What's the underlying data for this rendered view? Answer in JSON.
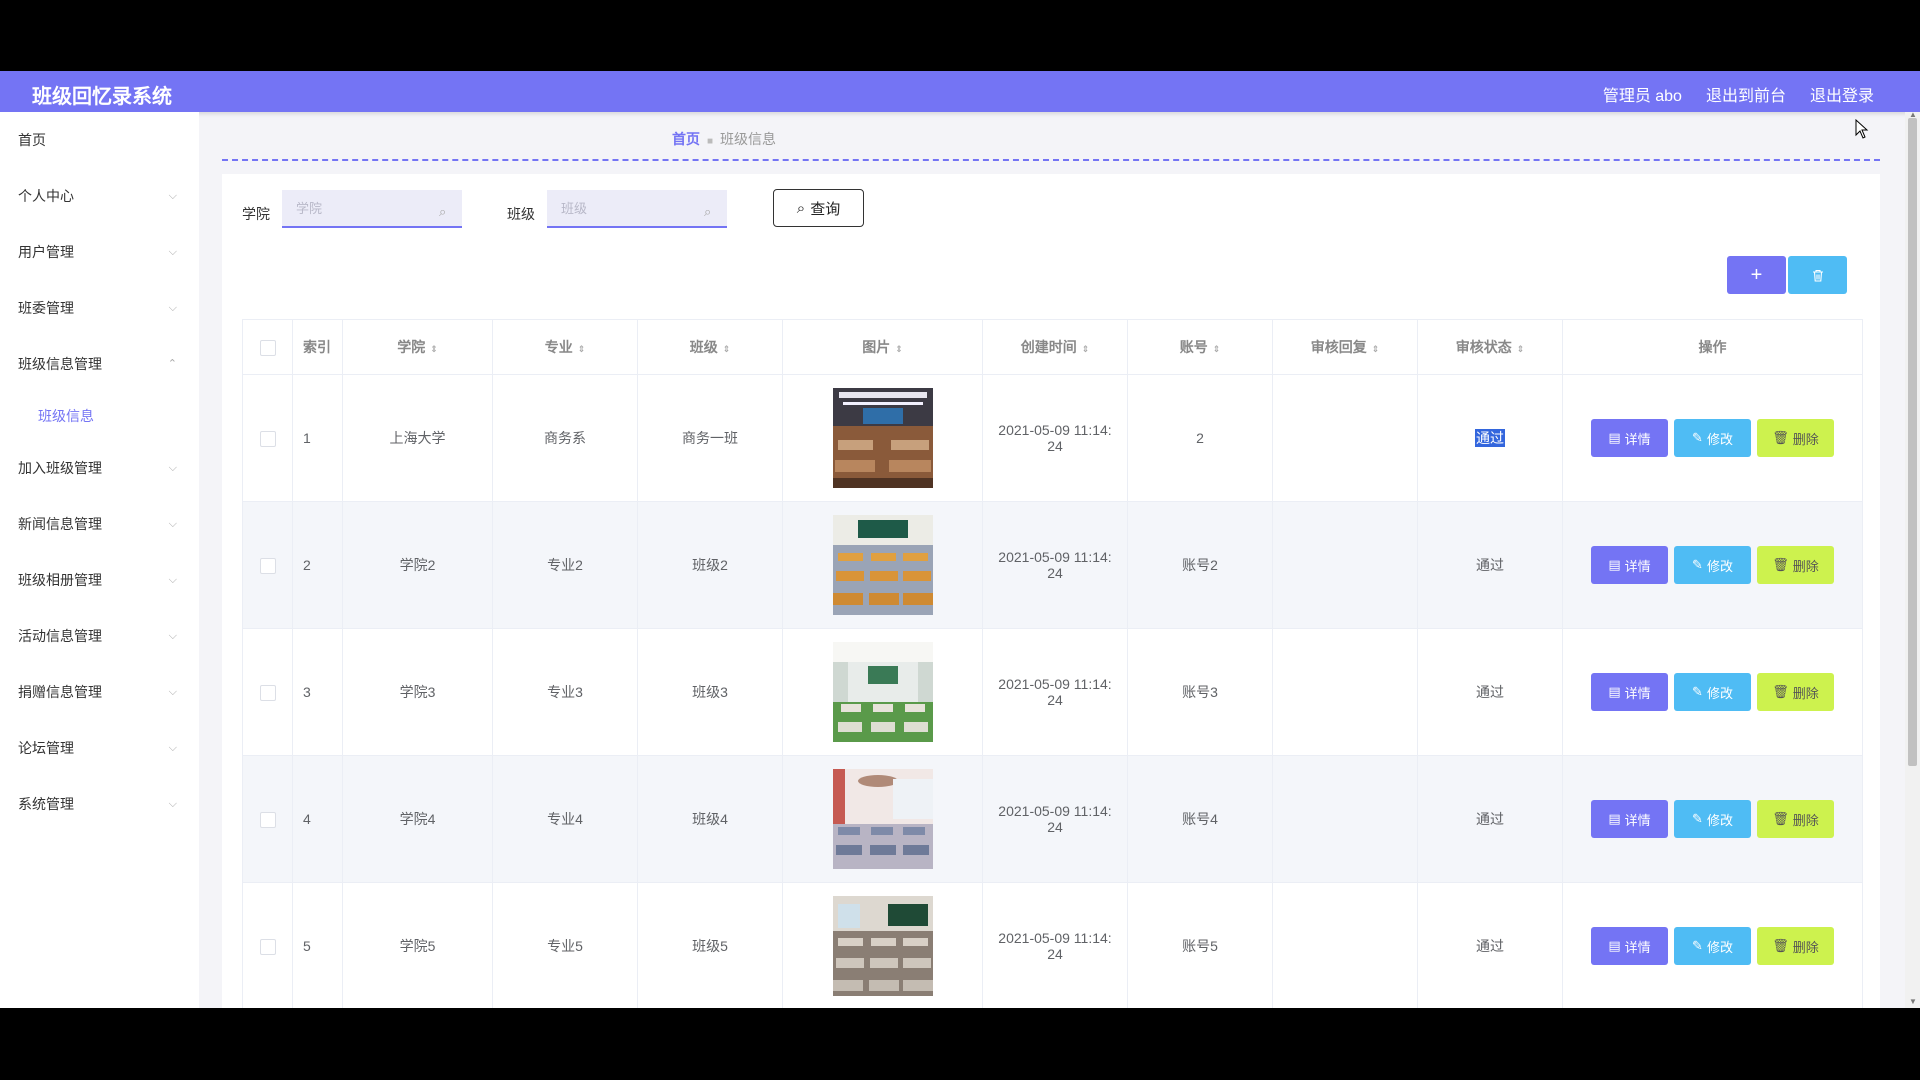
{
  "header": {
    "app_title": "班级回忆录系统",
    "admin_label": "管理员 abo",
    "to_frontend": "退出到前台",
    "logout": "退出登录",
    "accent_color": "#7474f4"
  },
  "sidebar": {
    "items": [
      {
        "label": "首页",
        "chevron": false
      },
      {
        "label": "个人中心",
        "chevron": true
      },
      {
        "label": "用户管理",
        "chevron": true
      },
      {
        "label": "班委管理",
        "chevron": true
      },
      {
        "label": "班级信息管理",
        "chevron": true,
        "expanded": true
      },
      {
        "label": "加入班级管理",
        "chevron": true
      },
      {
        "label": "新闻信息管理",
        "chevron": true
      },
      {
        "label": "班级相册管理",
        "chevron": true
      },
      {
        "label": "活动信息管理",
        "chevron": true
      },
      {
        "label": "捐赠信息管理",
        "chevron": true
      },
      {
        "label": "论坛管理",
        "chevron": true
      },
      {
        "label": "系统管理",
        "chevron": true
      }
    ],
    "sub_item": "班级信息"
  },
  "breadcrumb": {
    "home": "首页",
    "current": "班级信息"
  },
  "search": {
    "college_label": "学院",
    "college_placeholder": "学院",
    "class_label": "班级",
    "class_placeholder": "班级",
    "query_button": "查询"
  },
  "toolbar": {
    "add_icon": "plus-icon",
    "delete_icon": "trash-icon"
  },
  "table": {
    "headers": [
      "索引",
      "学院",
      "专业",
      "班级",
      "图片",
      "创建时间",
      "账号",
      "审核回复",
      "审核状态",
      "操作"
    ],
    "rows": [
      {
        "index": "1",
        "college": "上海大学",
        "major": "商务系",
        "class": "商务一班",
        "created": "2021-05-09 11:14:24",
        "account": "2",
        "reply": "",
        "status": "通过"
      },
      {
        "index": "2",
        "college": "学院2",
        "major": "专业2",
        "class": "班级2",
        "created": "2021-05-09 11:14:24",
        "account": "账号2",
        "reply": "",
        "status": "通过"
      },
      {
        "index": "3",
        "college": "学院3",
        "major": "专业3",
        "class": "班级3",
        "created": "2021-05-09 11:14:24",
        "account": "账号3",
        "reply": "",
        "status": "通过"
      },
      {
        "index": "4",
        "college": "学院4",
        "major": "专业4",
        "class": "班级4",
        "created": "2021-05-09 11:14:24",
        "account": "账号4",
        "reply": "",
        "status": "通过"
      },
      {
        "index": "5",
        "college": "学院5",
        "major": "专业5",
        "class": "班级5",
        "created": "2021-05-09 11:14:24",
        "account": "账号5",
        "reply": "",
        "status": "通过"
      }
    ],
    "actions": {
      "detail": "详情",
      "edit": "修改",
      "delete": "删除"
    }
  }
}
